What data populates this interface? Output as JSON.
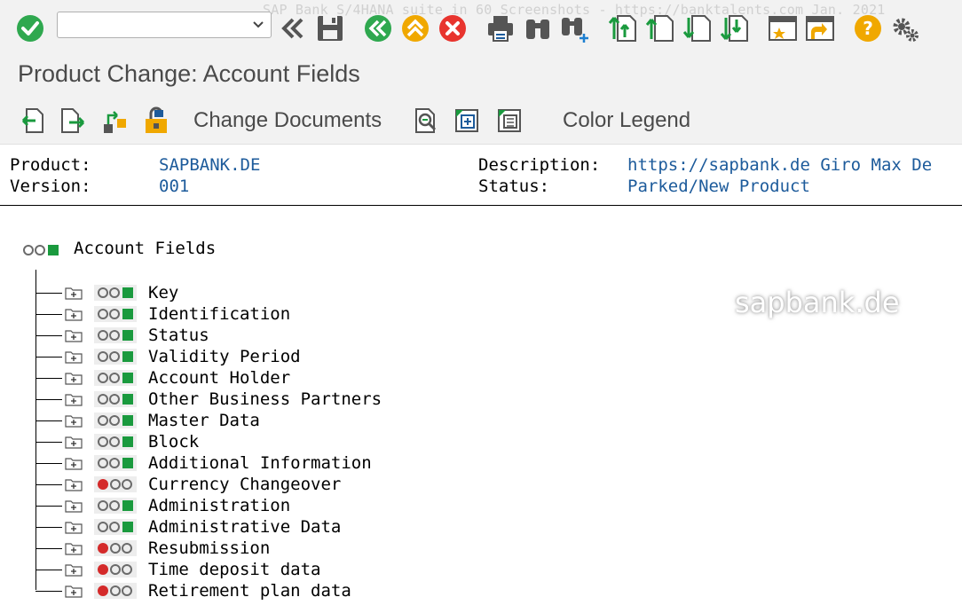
{
  "watermark_top": "SAP Bank S/4HANA suite in 60 Screenshots - https://banktalents.com Jan. 2021",
  "watermark_mid": "sapbank.de",
  "command_field": {
    "value": "",
    "placeholder": ""
  },
  "title": "Product Change: Account Fields",
  "app_toolbar": {
    "change_documents": "Change Documents",
    "color_legend": "Color Legend"
  },
  "header": {
    "product_label": "Product:",
    "product_value": "SAPBANK.DE",
    "version_label": "Version:",
    "version_value": "001",
    "description_label": "Description:",
    "description_value": "https://sapbank.de Giro Max De",
    "status_label": "Status:",
    "status_value": "Parked/New Product"
  },
  "tree": {
    "root": {
      "label": "Account Fields",
      "status": "green"
    },
    "nodes": [
      {
        "label": "Key",
        "status": "green"
      },
      {
        "label": "Identification",
        "status": "green"
      },
      {
        "label": "Status",
        "status": "green"
      },
      {
        "label": "Validity Period",
        "status": "green"
      },
      {
        "label": "Account Holder",
        "status": "green"
      },
      {
        "label": "Other Business Partners",
        "status": "green"
      },
      {
        "label": "Master Data",
        "status": "green"
      },
      {
        "label": "Block",
        "status": "green"
      },
      {
        "label": "Additional Information",
        "status": "green"
      },
      {
        "label": "Currency Changeover",
        "status": "red"
      },
      {
        "label": "Administration",
        "status": "green"
      },
      {
        "label": "Administrative Data",
        "status": "green"
      },
      {
        "label": "Resubmission",
        "status": "red"
      },
      {
        "label": "Time deposit data",
        "status": "red"
      },
      {
        "label": "Retirement plan data",
        "status": "red"
      }
    ]
  },
  "colors": {
    "green": "#1a9a3e",
    "red": "#d42a2a",
    "circle_outline": "#6b6b6b",
    "value_blue": "#1d5b9b",
    "toolbar_green": "#2fa84f",
    "toolbar_yellow": "#f0a800",
    "toolbar_red": "#e8342e"
  }
}
